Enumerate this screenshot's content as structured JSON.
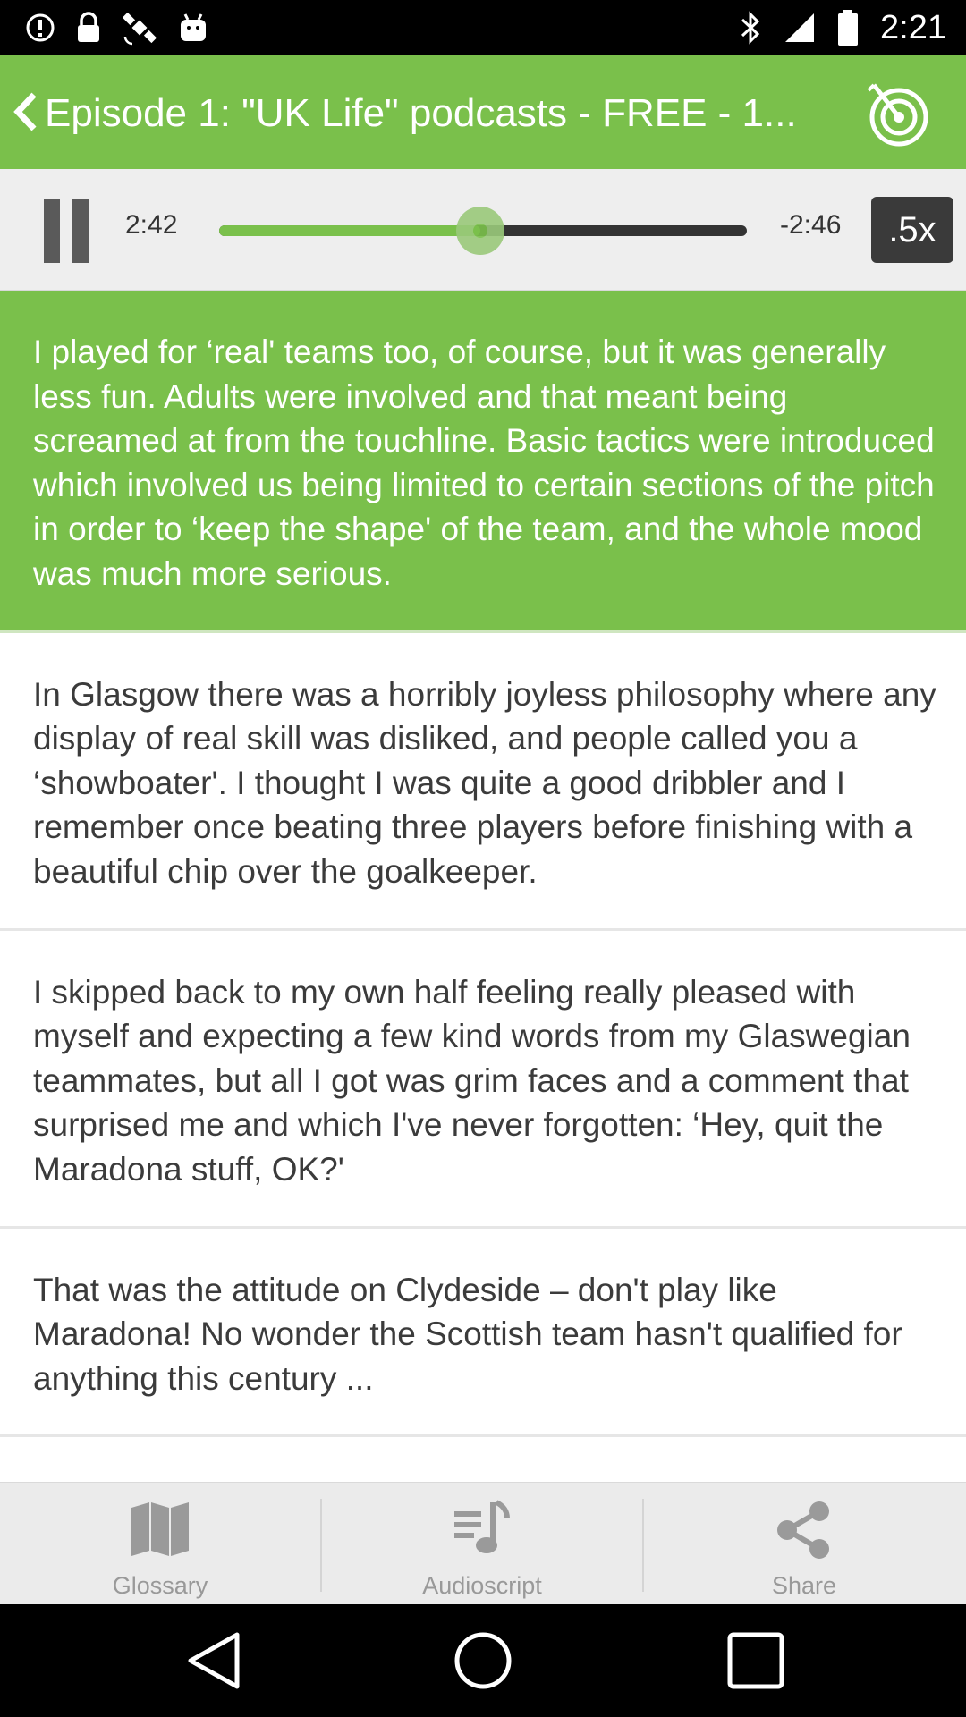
{
  "status_bar": {
    "time": "2:21",
    "left_icons": [
      "alert-icon",
      "lock-icon",
      "satellite-icon",
      "android-icon"
    ],
    "right_icons": [
      "bluetooth-icon",
      "signal-icon",
      "battery-icon"
    ]
  },
  "header": {
    "title": "Episode 1: \"UK Life\" podcasts - FREE - 1..."
  },
  "player": {
    "elapsed": "2:42",
    "remaining": "-2:46",
    "progress_fraction": 0.495,
    "speed": ".5x"
  },
  "paragraphs": [
    {
      "text": "I played for ‘real' teams too, of course, but it was generally less fun. Adults were involved and that meant being screamed at from the touchline. Basic tactics were introduced which involved us being limited to certain sections of the pitch in order to ‘keep the shape' of the team, and the whole mood was much more serious.",
      "highlighted": true
    },
    {
      "text": "In Glasgow there was a horribly joyless philosophy where any display of real skill was disliked, and people called you a ‘showboater'. I thought I was quite a good dribbler and I remember once beating three players before finishing with a beautiful chip over the goalkeeper.",
      "highlighted": false
    },
    {
      "text": "I skipped back to my own half feeling really pleased with myself and expecting a few kind words from my Glaswegian teammates, but all I got was grim faces and a comment that surprised me and which I've never forgotten: ‘Hey, quit the Maradona stuff, OK?'",
      "highlighted": false
    },
    {
      "text": "That was the attitude on Clydeside – don't play like Maradona! No wonder the Scottish team hasn't qualified for anything this century ...",
      "highlighted": false
    }
  ],
  "bottom_nav": {
    "glossary": "Glossary",
    "audioscript": "Audioscript",
    "share": "Share"
  },
  "colors": {
    "accent": "#7ac04b",
    "nav_label": "#999999"
  }
}
